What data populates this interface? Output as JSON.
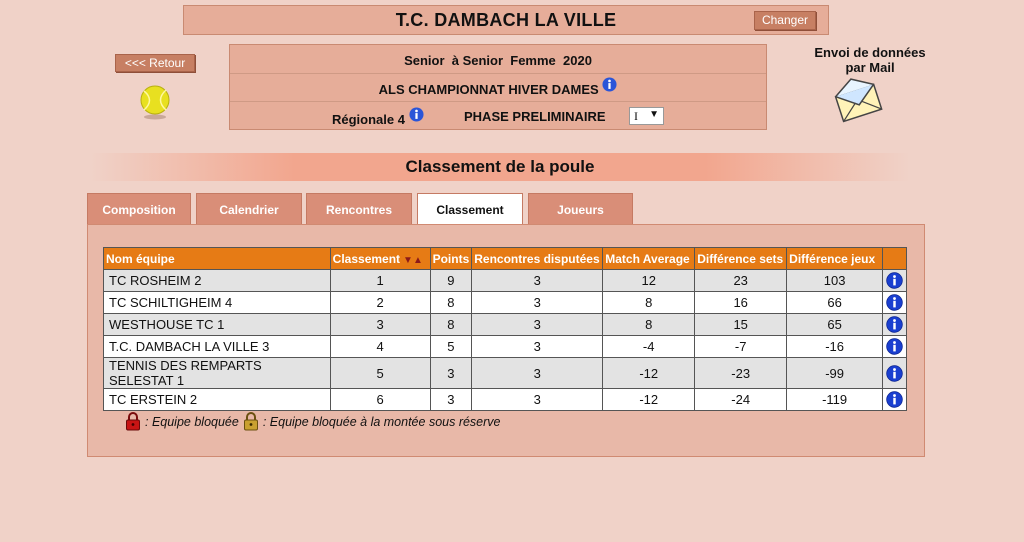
{
  "club": {
    "name": "T.C. DAMBACH LA VILLE",
    "change_label": "Changer"
  },
  "back_label": "<<< Retour",
  "competition": {
    "category": "Senior  à Senior  Femme  2020",
    "championship": "ALS CHAMPIONNAT HIVER DAMES",
    "division": "Régionale 4",
    "phase": "PHASE PRELIMINAIRE",
    "phase_select": "I"
  },
  "mail": {
    "line1": "Envoi de données",
    "line2": "par Mail"
  },
  "section_title": "Classement de la poule",
  "tabs": [
    {
      "label": "Composition"
    },
    {
      "label": "Calendrier"
    },
    {
      "label": "Rencontres"
    },
    {
      "label": "Classement",
      "active": true
    },
    {
      "label": "Joueurs"
    }
  ],
  "table": {
    "headers": [
      "Nom équipe",
      "Classement",
      "Points",
      "Rencontres disputées",
      "Match Average",
      "Différence sets",
      "Différence jeux"
    ],
    "rows": [
      [
        "TC ROSHEIM 2",
        "1",
        "9",
        "3",
        "12",
        "23",
        "103"
      ],
      [
        "TC SCHILTIGHEIM 4",
        "2",
        "8",
        "3",
        "8",
        "16",
        "66"
      ],
      [
        "WESTHOUSE TC 1",
        "3",
        "8",
        "3",
        "8",
        "15",
        "65"
      ],
      [
        "T.C. DAMBACH LA VILLE 3",
        "4",
        "5",
        "3",
        "-4",
        "-7",
        "-16"
      ],
      [
        "TENNIS DES REMPARTS SELESTAT 1",
        "5",
        "3",
        "3",
        "-12",
        "-23",
        "-99"
      ],
      [
        "TC ERSTEIN 2",
        "6",
        "3",
        "3",
        "-12",
        "-24",
        "-119"
      ]
    ]
  },
  "legend": {
    "blocked": ": Equipe bloquée",
    "blocked_promotion": ": Equipe bloquée à la montée sous réserve"
  },
  "colors": {
    "header_orange": "#e67b15",
    "tab": "#d98e78",
    "info_blue": "#1a3fd0"
  }
}
